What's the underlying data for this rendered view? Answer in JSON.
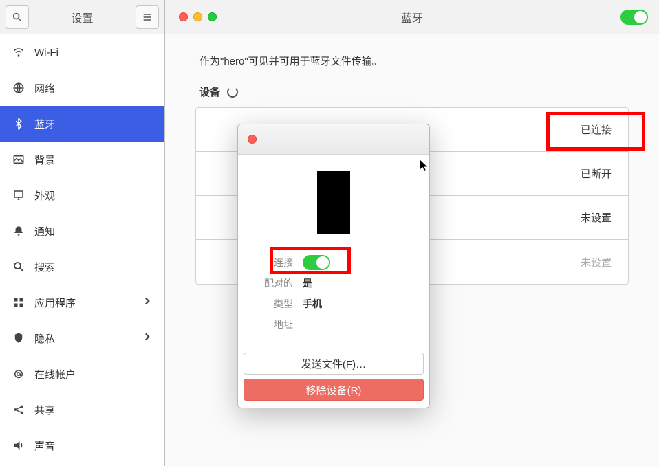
{
  "header": {
    "settings_label": "设置",
    "page_title": "蓝牙"
  },
  "sidebar": {
    "items": [
      {
        "label": "Wi-Fi",
        "icon": "wifi",
        "has_chevron": false
      },
      {
        "label": "网络",
        "icon": "network",
        "has_chevron": false
      },
      {
        "label": "蓝牙",
        "icon": "bluetooth",
        "has_chevron": false,
        "active": true
      },
      {
        "label": "背景",
        "icon": "background",
        "has_chevron": false
      },
      {
        "label": "外观",
        "icon": "appearance",
        "has_chevron": false
      },
      {
        "label": "通知",
        "icon": "notifications",
        "has_chevron": false
      },
      {
        "label": "搜索",
        "icon": "search",
        "has_chevron": false
      },
      {
        "label": "应用程序",
        "icon": "apps",
        "has_chevron": true
      },
      {
        "label": "隐私",
        "icon": "privacy",
        "has_chevron": true
      },
      {
        "label": "在线帐户",
        "icon": "accounts",
        "has_chevron": false
      },
      {
        "label": "共享",
        "icon": "share",
        "has_chevron": false
      },
      {
        "label": "声音",
        "icon": "sound",
        "has_chevron": false
      }
    ]
  },
  "content": {
    "visibility_text": "作为\"hero\"可见并可用于蓝牙文件传输。",
    "devices_label": "设备",
    "device_rows": [
      {
        "status": "已连接"
      },
      {
        "status": "已断开"
      },
      {
        "status": "未设置"
      },
      {
        "status": "未设置"
      }
    ]
  },
  "dialog": {
    "connection_label": "连接",
    "paired_label": "配对的",
    "paired_value": "是",
    "type_label": "类型",
    "type_value": "手机",
    "address_label": "地址",
    "address_value": "",
    "send_file_label": "发送文件(F)…",
    "remove_device_label": "移除设备(R)"
  }
}
